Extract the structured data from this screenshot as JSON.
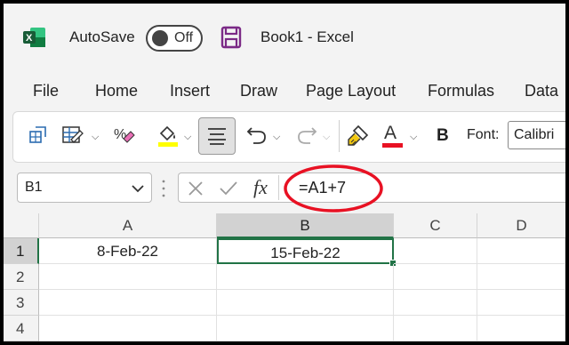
{
  "app": {
    "autosave_label": "AutoSave",
    "autosave_state": "Off",
    "doc_title": "Book1  -  Excel"
  },
  "menu": [
    "File",
    "Home",
    "Insert",
    "Draw",
    "Page Layout",
    "Formulas",
    "Data"
  ],
  "ribbon": {
    "font_label": "Font:",
    "font_value": "Calibri",
    "bold_label": "B",
    "font_color": "#e81123",
    "highlight_color": "#ffff00",
    "icons": [
      "format-cells-icon",
      "table-format-icon",
      "percent-style-icon",
      "fill-color-icon",
      "align-center-icon",
      "undo-icon",
      "redo-icon",
      "format-painter-icon",
      "font-color-icon"
    ]
  },
  "formula_bar": {
    "name_box": "B1",
    "fx_label": "fx",
    "formula": "=A1+7",
    "annotation_color": "#e81123"
  },
  "sheet": {
    "columns": [
      "A",
      "B",
      "C",
      "D"
    ],
    "rows": [
      "1",
      "2",
      "3",
      "4"
    ],
    "cells": {
      "A1": "8-Feb-22",
      "B1": "15-Feb-22"
    },
    "selected_cell": "B1",
    "selection_color": "#217346"
  }
}
